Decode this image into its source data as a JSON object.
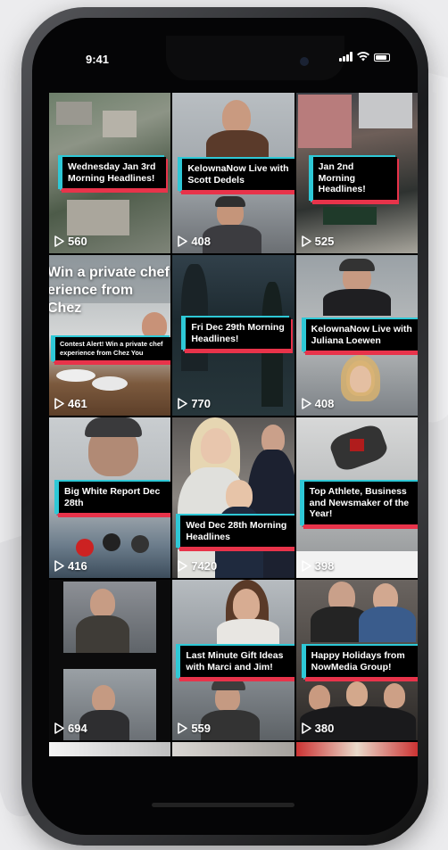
{
  "status_bar": {
    "time": "9:41"
  },
  "videos": [
    {
      "caption": "Wednesday Jan 3rd Morning Headlines!",
      "views": "560"
    },
    {
      "caption": "KelownaNow Live with Scott Dedels",
      "views": "408"
    },
    {
      "caption": "Jan 2nd Morning Headlines!",
      "views": "525"
    },
    {
      "caption": "Contest Alert! Win a private chef experience from Chez You",
      "overlay_text": "Win a private chef\nerience from Chez",
      "views": "461"
    },
    {
      "caption": "Fri Dec 29th Morning Headlines!",
      "views": "770"
    },
    {
      "caption": "KelownaNow Live with Juliana Loewen",
      "views": "408"
    },
    {
      "caption": "Big White Report Dec 28th",
      "views": "416"
    },
    {
      "caption": "Wed Dec 28th Morning Headlines",
      "views": "7420"
    },
    {
      "caption": "Top Athlete, Business and Newsmaker of the Year!",
      "views": "398"
    },
    {
      "caption": "",
      "views": "694"
    },
    {
      "caption": "Last Minute Gift Ideas with Marci and Jim!",
      "views": "559"
    },
    {
      "caption": "Happy Holidays from NowMedia Group!",
      "views": "380"
    }
  ],
  "colors": {
    "caption_accent_cyan": "#2ec8d6",
    "caption_accent_red": "#e8334a",
    "caption_bg": "#000000"
  }
}
